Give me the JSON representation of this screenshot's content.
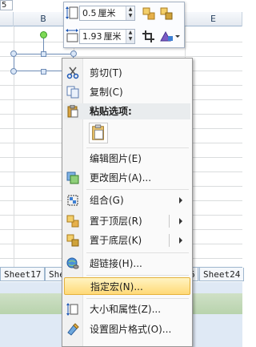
{
  "spreadsheet": {
    "name_box": "5",
    "columns": [
      "B",
      "E"
    ],
    "sheet_tabs": [
      "Sheet17",
      "She",
      "6",
      "Sheet24"
    ]
  },
  "mini_toolbar": {
    "height_value": "0.5",
    "height_unit": "厘米",
    "width_value": "1.93",
    "width_unit": "厘米",
    "spin_up": "▲",
    "spin_down": "▼"
  },
  "context_menu": {
    "items": [
      {
        "label": "剪切(T)",
        "icon": "scissors-icon"
      },
      {
        "label": "复制(C)",
        "icon": "copy-icon"
      },
      {
        "label": "粘贴选项:",
        "icon": "paste-icon"
      },
      {
        "label": "编辑图片(E)",
        "icon": ""
      },
      {
        "label": "更改图片(A)...",
        "icon": "change-picture-icon"
      },
      {
        "label": "组合(G)",
        "icon": "group-icon"
      },
      {
        "label": "置于顶层(R)",
        "icon": "bring-to-front-icon"
      },
      {
        "label": "置于底层(K)",
        "icon": "send-to-back-icon"
      },
      {
        "label": "超链接(H)...",
        "icon": "hyperlink-icon"
      },
      {
        "label": "指定宏(N)...",
        "icon": ""
      },
      {
        "label": "大小和属性(Z)...",
        "icon": "size-properties-icon"
      },
      {
        "label": "设置图片格式(O)...",
        "icon": "format-picture-icon"
      }
    ],
    "highlighted_item": "指定宏(N)..."
  },
  "colors": {
    "menu_highlight": "#ffd977",
    "menu_border": "#979797",
    "selection_handle": "#6d8bb5",
    "rotation_handle": "#7ed957"
  }
}
